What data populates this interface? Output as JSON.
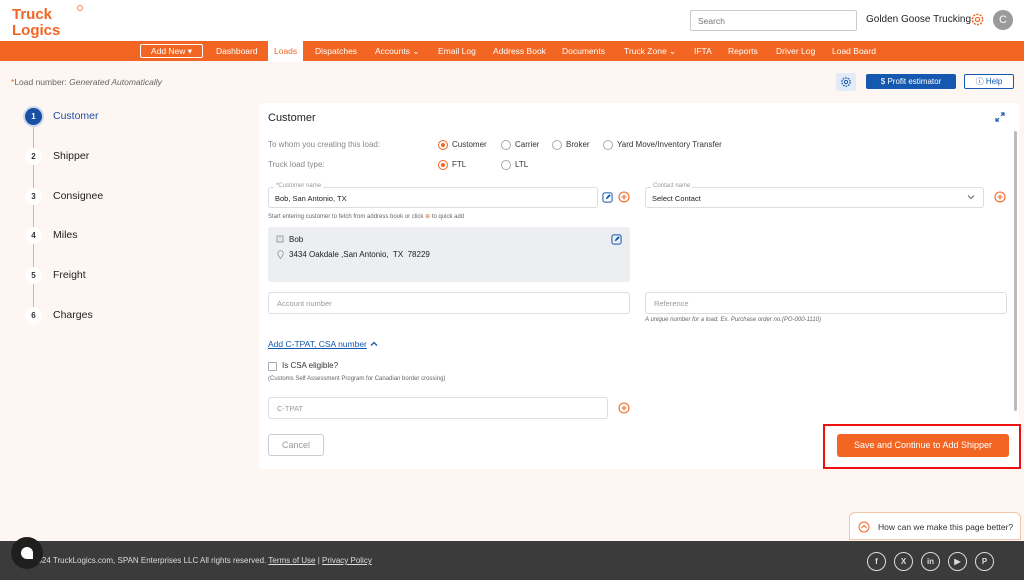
{
  "header": {
    "logo_line1": "Truck",
    "logo_line2": "Logics",
    "search_placeholder": "Search",
    "company": "Golden Goose Trucking",
    "avatar_letter": "C"
  },
  "nav": {
    "add_new": "Add New",
    "items": [
      "Dashboard",
      "Loads",
      "Dispatches",
      "Accounts",
      "Email Log",
      "Address Book",
      "Documents",
      "Truck Zone",
      "IFTA",
      "Reports",
      "Driver Log",
      "Load Board"
    ],
    "active": "Loads"
  },
  "subheader": {
    "load_number_label": "Load number:",
    "load_number_value": "Generated Automatically",
    "profit_estimator": "Profit estimator",
    "help": "Help"
  },
  "steps": [
    {
      "num": "1",
      "label": "Customer"
    },
    {
      "num": "2",
      "label": "Shipper"
    },
    {
      "num": "3",
      "label": "Consignee"
    },
    {
      "num": "4",
      "label": "Miles"
    },
    {
      "num": "5",
      "label": "Freight"
    },
    {
      "num": "6",
      "label": "Charges"
    }
  ],
  "form": {
    "title": "Customer",
    "whom_label": "To whom you creating this load:",
    "whom_options": [
      "Customer",
      "Carrier",
      "Broker",
      "Yard Move/Inventory Transfer"
    ],
    "whom_selected": "Customer",
    "type_label": "Truck load type:",
    "type_options": [
      "FTL",
      "LTL"
    ],
    "type_selected": "FTL",
    "customer_name_label": "Customer name",
    "customer_name_value": "Bob, San Antonio, TX",
    "customer_hint_a": "Start entering customer to fetch from address book or click",
    "customer_hint_b": "to quick add",
    "contact_label": "Contact name",
    "contact_value": "Select Contact",
    "address_name": "Bob",
    "address_line": "3434 Oakdale ,San Antonio,  TX  78229",
    "account_placeholder": "Account number",
    "reference_placeholder": "Reference",
    "reference_hint": "A unique number for a load. Ex. Purchase order no.(PO-000-1110)",
    "ctpat_link": "Add C-TPAT, CSA number",
    "csa_label": "Is CSA eligible?",
    "csa_hint": "(Customs Self Assessment Program for Canadian border crossing)",
    "ctpat_placeholder": "C-TPAT",
    "cancel": "Cancel",
    "save": "Save and Continue to Add Shipper"
  },
  "feedback": "How can we make this page better?",
  "footer": {
    "copyright": "2024 TruckLogics.com, SPAN Enterprises LLC All rights reserved.",
    "terms": "Terms of Use",
    "separator": "|",
    "privacy": "Privacy Policy",
    "social": [
      "facebook-icon",
      "x-icon",
      "linkedin-icon",
      "youtube-icon",
      "pinterest-icon"
    ]
  },
  "colors": {
    "brand_orange": "#f26522",
    "primary_blue": "#1558b0",
    "highlight_red": "#e11111"
  }
}
